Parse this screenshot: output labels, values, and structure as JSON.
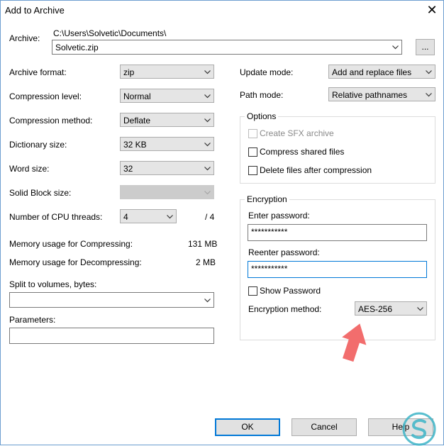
{
  "window": {
    "title": "Add to Archive"
  },
  "archive": {
    "label": "Archive:",
    "path": "C:\\Users\\Solvetic\\Documents\\",
    "name": "Solvetic.zip",
    "browse_label": "..."
  },
  "left": {
    "format_label": "Archive format:",
    "format_value": "zip",
    "level_label": "Compression level:",
    "level_value": "Normal",
    "method_label": "Compression method:",
    "method_value": "Deflate",
    "dict_label": "Dictionary size:",
    "dict_value": "32 KB",
    "word_label": "Word size:",
    "word_value": "32",
    "solid_label": "Solid Block size:",
    "solid_value": "",
    "threads_label": "Number of CPU threads:",
    "threads_value": "4",
    "threads_total": "/ 4",
    "mem_comp_label": "Memory usage for Compressing:",
    "mem_comp_value": "131 MB",
    "mem_decomp_label": "Memory usage for Decompressing:",
    "mem_decomp_value": "2 MB",
    "split_label": "Split to volumes, bytes:",
    "split_value": "",
    "params_label": "Parameters:",
    "params_value": ""
  },
  "right": {
    "update_label": "Update mode:",
    "update_value": "Add and replace files",
    "path_label": "Path mode:",
    "path_value": "Relative pathnames",
    "options": {
      "legend": "Options",
      "sfx": "Create SFX archive",
      "shared": "Compress shared files",
      "delete": "Delete files after compression"
    },
    "encryption": {
      "legend": "Encryption",
      "enter_label": "Enter password:",
      "enter_value": "***********",
      "reenter_label": "Reenter password:",
      "reenter_value": "***********",
      "show": "Show Password",
      "method_label": "Encryption method:",
      "method_value": "AES-256"
    }
  },
  "buttons": {
    "ok": "OK",
    "cancel": "Cancel",
    "help": "Help"
  },
  "colors": {
    "accent": "#0078d7",
    "hint_arrow": "#f26d6d",
    "logo": "#3cb4c7"
  }
}
